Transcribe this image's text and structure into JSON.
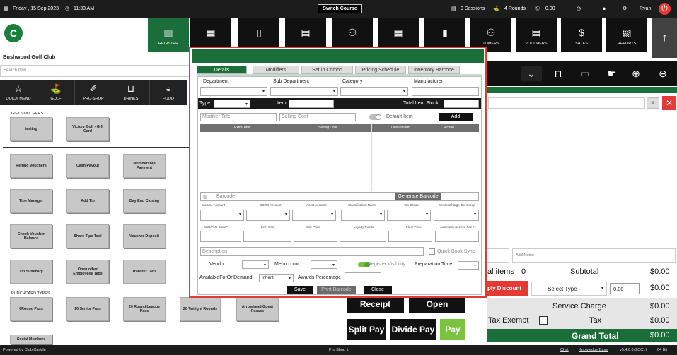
{
  "topbar": {
    "date": "Friday , 15 Sep 2023",
    "time": "11:33 AM",
    "switch_course": "Switch Course",
    "sessions": "0 Sessions",
    "rounds": "4 Rounds",
    "balance": "0.00",
    "user": "Ryan"
  },
  "club": {
    "name": "Bushwood Golf Club",
    "logo_text": "C"
  },
  "nav": {
    "register": "REGISTER",
    "customers": "TOMERS",
    "vouchers": "VOUCHERS",
    "sales": "SALES",
    "reports": "REPORTS"
  },
  "search": {
    "placeholder": "Search Item"
  },
  "categories": [
    "QUICK MENU",
    "GOLF",
    "PRO-SHOP",
    "DRINKS",
    "FOOD"
  ],
  "sections": {
    "gift_vouchers": "GIFT VOUCHERS",
    "punchcard_types": "PUNCHCARD TYPES"
  },
  "tiles": {
    "testing": "testing",
    "victory_gift": "Victory Golf - Gift Card",
    "refund_vouchers": "Refund Vouchers",
    "cash_payout": "Cash Payout",
    "membership_payment": "Membership Payment",
    "tips_manager": "Tips Manager",
    "add_tip": "Add Tip",
    "day_end_closing": "Day End Closing",
    "check_voucher_balance": "Check Voucher Balance",
    "share_tips_tool": "Share Tips Tool",
    "voucher_deposit": "Voucher Deposit",
    "tip_summary": "Tip Summary",
    "open_other_tabs": "Open other Employees Tabs",
    "transfer_tabs": "Transfer Tabs",
    "round_pass_6": "6Round Pass",
    "senior_pass_10": "10 Senior Pass",
    "league_pass_20": "20 Round League Pass",
    "twilight_rounds_20": "20 Twilight Rounds",
    "arrowhead_guest": "Arrowhead Guest Passes",
    "social_members": "Social Members"
  },
  "right_panel": {
    "notes_placeholder": "Add Notes",
    "total_items_label": "al items",
    "total_items": "0",
    "subtotal_label": "Subtotal",
    "subtotal": "$0.00",
    "apply_discount": "ply Discount",
    "discount_type": "Select Type",
    "discount_value": "0.00",
    "discount_amount": "$0.00",
    "service_charge_label": "Service Charge",
    "service_charge": "$0.00",
    "tax_exempt_label": "Tax Exempt",
    "tax_label": "Tax",
    "tax": "$0.00",
    "grand_total_label": "Grand Total",
    "grand_total": "$0.00"
  },
  "pay_buttons": {
    "receipt": "Receipt",
    "open": "Open",
    "split_pay": "Split Pay",
    "divide_pay": "Divide Pay",
    "pay": "Pay"
  },
  "modal": {
    "tabs": [
      "Details",
      "Modifiers",
      "Setup Combo",
      "Pricing Schedule",
      "Inventory Barcode"
    ],
    "department": "Department",
    "sub_department": "Sub Department",
    "category": "Category",
    "manufacturer": "Manufacturer",
    "type": "Type",
    "item": "Item",
    "total_item_stock": "Total Item Stock",
    "modifier_title_ph": "Modifier Title",
    "selling_cost_ph": "Selling Cost",
    "default_item": "Default Item",
    "add": "Add",
    "table_headers": [
      "Extra Title",
      "Selling Cost",
      "Default Item",
      "Action"
    ],
    "barcode_ph": "Barcode",
    "generate_barcode": "Generate Barcode",
    "row1_labels": [
      "Income Account",
      "COGS Account",
      "Asset Account",
      "Classification Name",
      "Tax Group",
      "ServiceCharge Tax Group"
    ],
    "row2_labels": [
      "SKU/PLU Code#",
      "Item Cost",
      "Sale Price",
      "Loyalty Points",
      "Floor Price",
      "Automatic Service Fee %"
    ],
    "description_ph": "Description",
    "quick_book_sync": "Quick Book Sync",
    "vendor": "Vendor",
    "menu_color": "Menu color",
    "register_visibility": "Register Visibility",
    "preparation_time": "Preparation Time",
    "available_on_demand": "AvailableForOnDemand",
    "inherit": "Inherit",
    "awards_percentage": "Awards Percentage",
    "save": "Save",
    "print_barcode": "Print Barcode",
    "close": "Close"
  },
  "footer": {
    "powered": "Powered by Club Caddie",
    "station": "Pro Shop 1",
    "chat": "Chat",
    "kb": "Knowledge Base",
    "version": "v5.4.6.6@CC17",
    "bits": "64 Bit"
  },
  "colors": {
    "brand_green": "#1b6e3a",
    "alert_red": "#e53935",
    "pay_green": "#7cc241"
  }
}
